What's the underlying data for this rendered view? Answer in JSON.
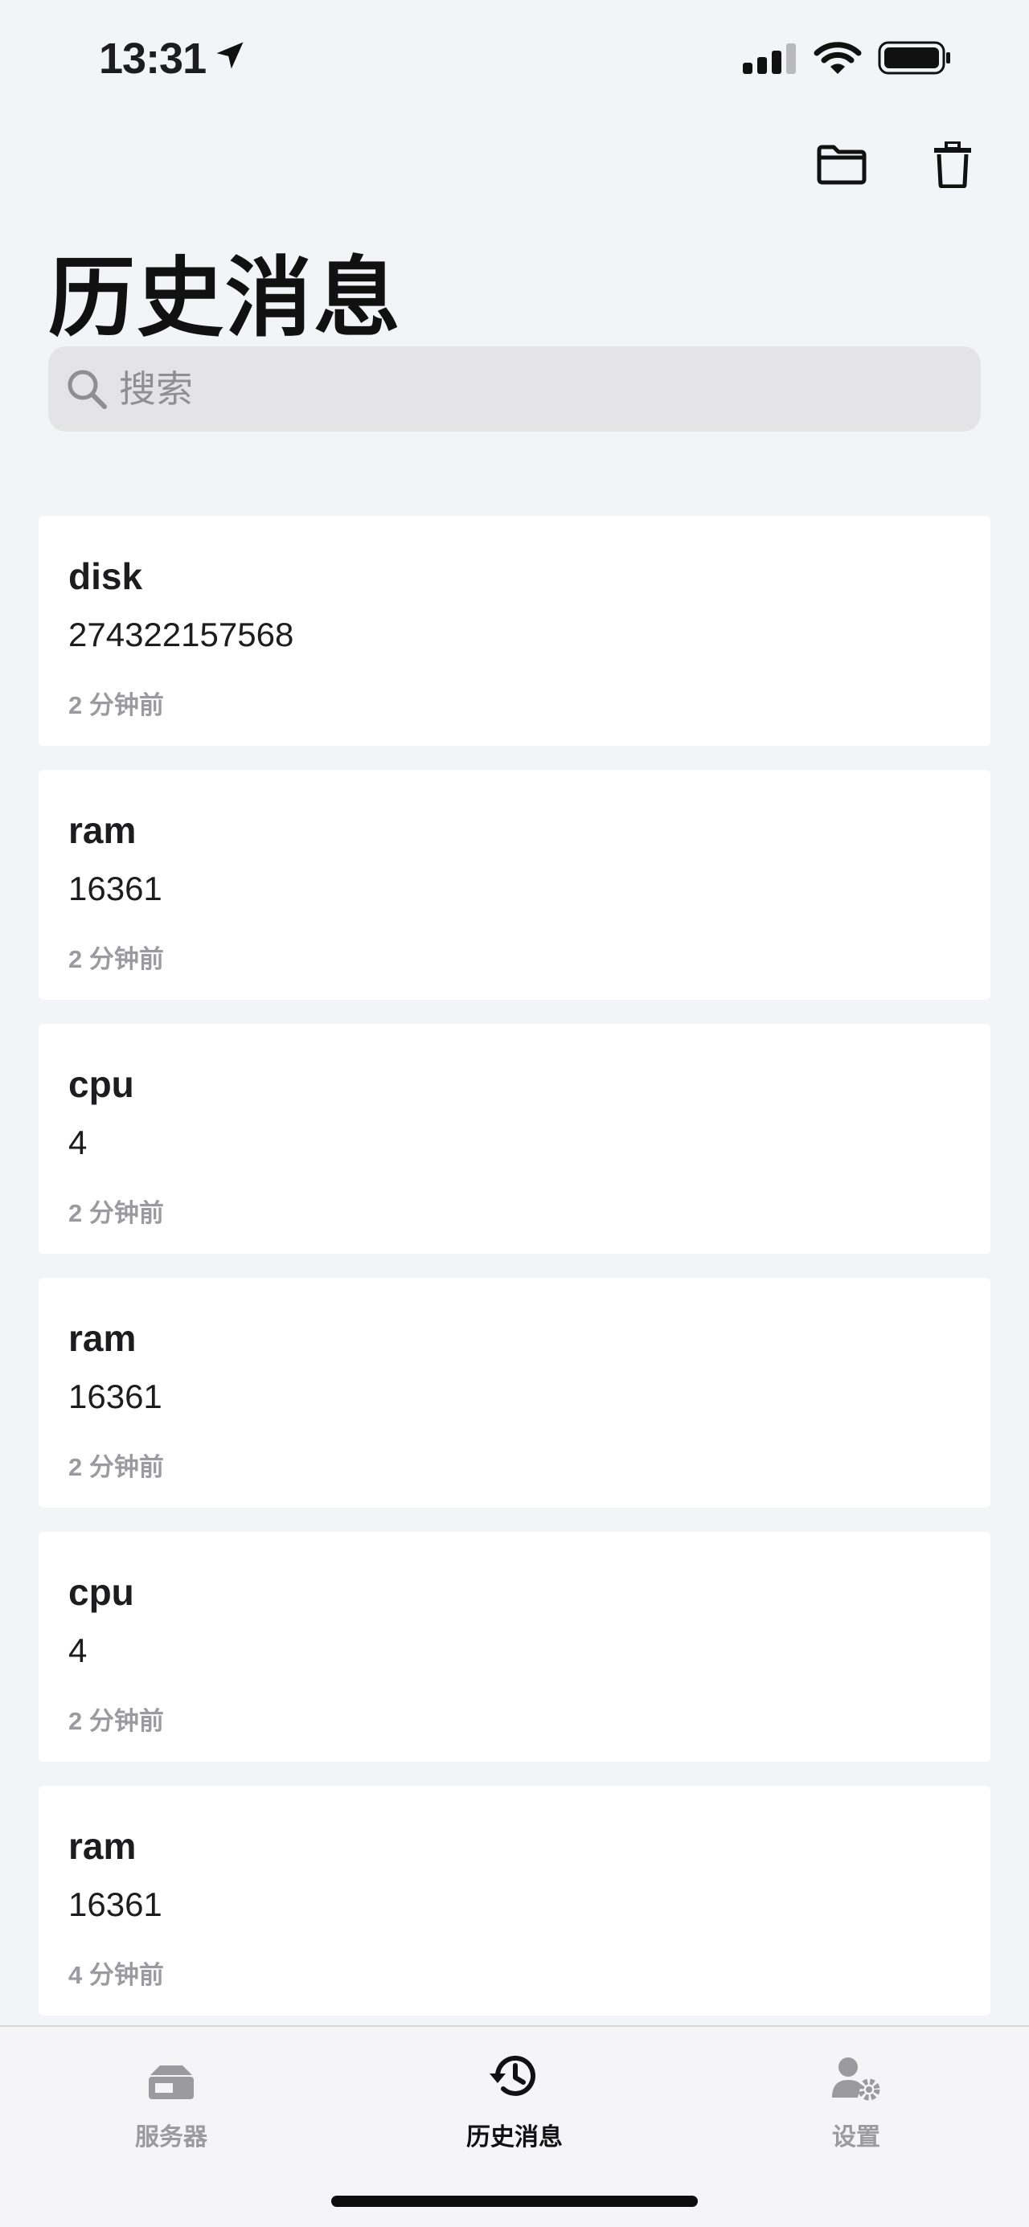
{
  "status_bar": {
    "time": "13:31"
  },
  "header": {
    "title": "历史消息"
  },
  "search": {
    "placeholder": "搜索",
    "value": ""
  },
  "messages": [
    {
      "title": "disk",
      "value": "274322157568",
      "time": "2 分钟前"
    },
    {
      "title": "ram",
      "value": "16361",
      "time": "2 分钟前"
    },
    {
      "title": "cpu",
      "value": "4",
      "time": "2 分钟前"
    },
    {
      "title": "ram",
      "value": "16361",
      "time": "2 分钟前"
    },
    {
      "title": "cpu",
      "value": "4",
      "time": "2 分钟前"
    },
    {
      "title": "ram",
      "value": "16361",
      "time": "4 分钟前"
    }
  ],
  "tabs": [
    {
      "label": "服务器",
      "icon": "server-icon",
      "active": false
    },
    {
      "label": "历史消息",
      "icon": "history-icon",
      "active": true
    },
    {
      "label": "设置",
      "icon": "settings-icon",
      "active": false
    }
  ],
  "colors": {
    "background": "#f3f4f7",
    "card": "#ffffff",
    "inactive": "#9a9a9f",
    "active": "#111111"
  }
}
